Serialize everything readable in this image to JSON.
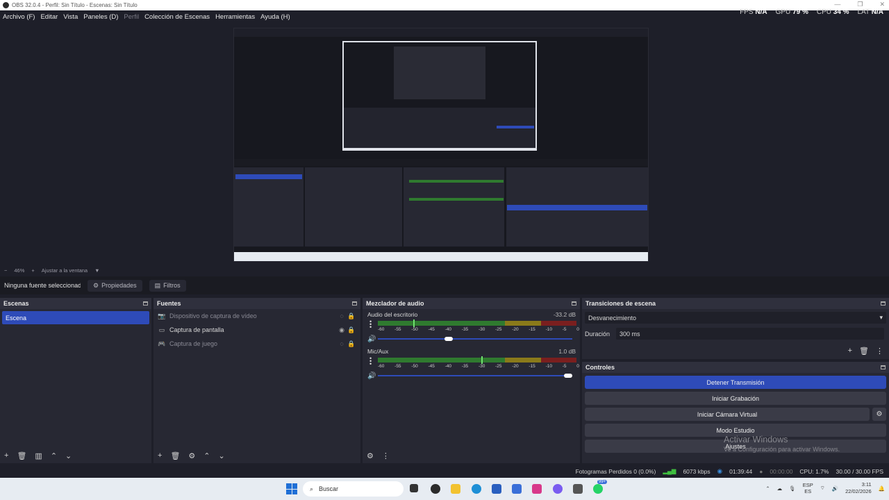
{
  "window": {
    "title": "OBS 32.0.4 - Perfil: Sin Título - Escenas: Sin Título"
  },
  "menu": [
    "Archivo (F)",
    "Editar",
    "Vista",
    "Paneles (D)",
    "Perfil",
    "Colección de Escenas",
    "Herramientas",
    "Ayuda (H)"
  ],
  "stats": {
    "fps_label": "FPS",
    "fps": "N/A",
    "gpu_label": "GPU",
    "gpu": "79 %",
    "cpu_label": "CPU",
    "cpu": "34 %",
    "lat_label": "LAT",
    "lat": "N/A"
  },
  "zoom": {
    "minus": "−",
    "value": "46%",
    "plus": "+",
    "fit": "Ajustar a la ventana"
  },
  "context": {
    "source": "Ninguna fuente seleccionada",
    "properties": "Propiedades",
    "filters": "Filtros"
  },
  "scenes": {
    "title": "Escenas",
    "items": [
      "Escena"
    ]
  },
  "sources": {
    "title": "Fuentes",
    "items": [
      {
        "label": "Dispositivo de captura de vídeo",
        "visible": false
      },
      {
        "label": "Captura de pantalla",
        "visible": true
      },
      {
        "label": "Captura de juego",
        "visible": false
      }
    ]
  },
  "mixer": {
    "title": "Mezclador de audio",
    "channels": [
      {
        "name": "Audio del escritorio",
        "db": "-33.2 dB",
        "level": 0.18,
        "volume": 0.36
      },
      {
        "name": "Mic/Aux",
        "db": "1.0 dB",
        "level": 0.52,
        "volume": 1.0
      }
    ],
    "ticks": [
      "-60",
      "-55",
      "-50",
      "-45",
      "-40",
      "-35",
      "-30",
      "-25",
      "-20",
      "-15",
      "-10",
      "-5",
      "0"
    ]
  },
  "transitions": {
    "title": "Transiciones de escena",
    "selected": "Desvanecimiento",
    "duration_label": "Duración",
    "duration": "300 ms"
  },
  "controls": {
    "title": "Controles",
    "buttons": [
      "Detener Transmisión",
      "Iniciar Grabación",
      "Iniciar Cámara Virtual",
      "Modo Estudio",
      "Ajustes"
    ]
  },
  "activation": {
    "line1": "Activar Windows",
    "line2": "Ve a Configuración para activar Windows."
  },
  "status": {
    "dropped": "Fotogramas Perdidos 0 (0.0%)",
    "bitrate": "6073 kbps",
    "stream_time": "01:39:44",
    "rec_time": "00:00:00",
    "cpu": "CPU: 1.7%",
    "fps": "30.00 / 30.00 FPS"
  },
  "taskbar": {
    "search": "Buscar",
    "badge": "99+",
    "lang1": "ESP",
    "lang2": "ES",
    "time": "3:11",
    "date": "22/02/2026"
  },
  "colors": {
    "accent": "#2e4bb8",
    "bg": "#1e1f29",
    "dock": "#272833"
  }
}
